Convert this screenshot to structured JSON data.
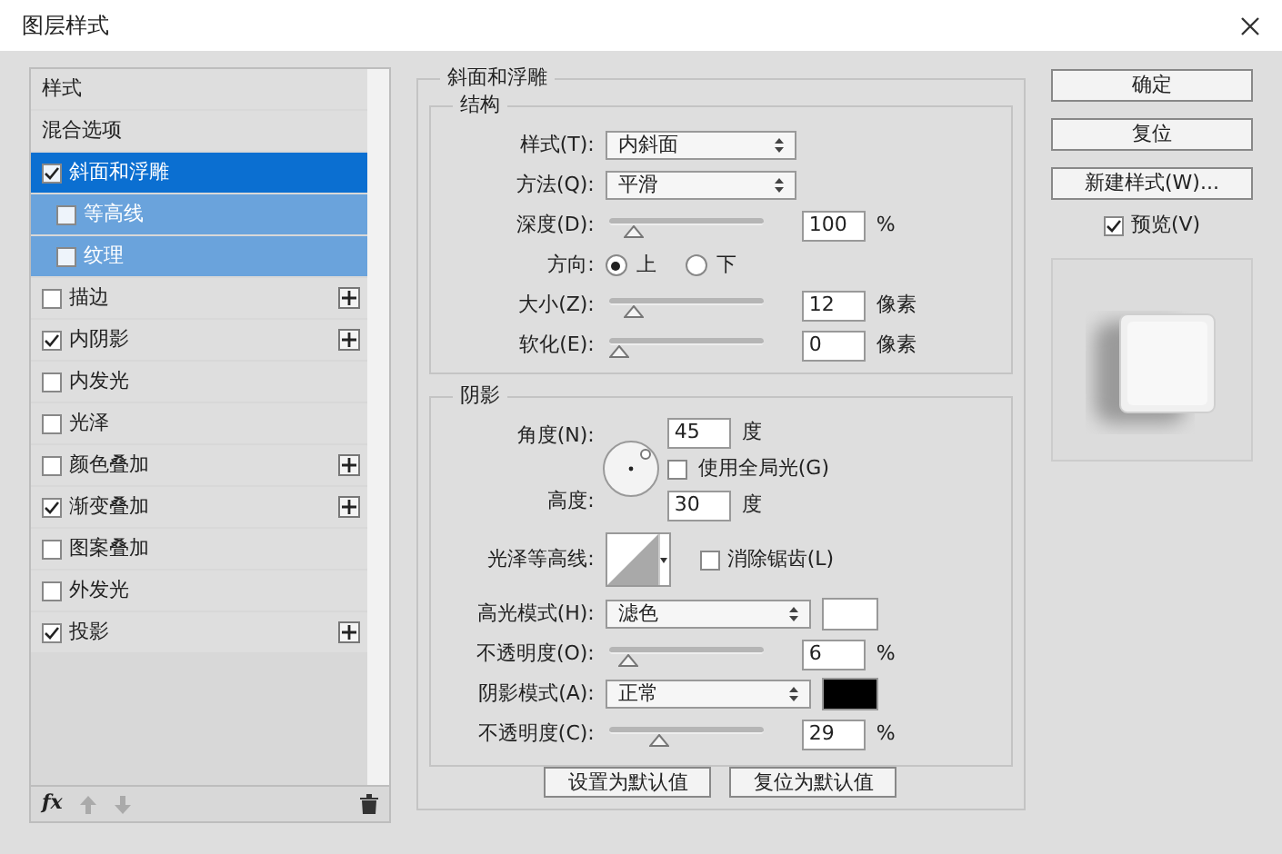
{
  "window": {
    "title": "图层样式"
  },
  "styles": [
    {
      "label": "样式",
      "kind": "header",
      "selected": false
    },
    {
      "label": "混合选项",
      "kind": "header",
      "selected": false
    },
    {
      "label": "斜面和浮雕",
      "kind": "effect",
      "checked": true,
      "selected": true,
      "add": false
    },
    {
      "label": "等高线",
      "kind": "sub",
      "checked": false,
      "selected": false,
      "add": false
    },
    {
      "label": "纹理",
      "kind": "sub",
      "checked": false,
      "selected": false,
      "add": false
    },
    {
      "label": "描边",
      "kind": "effect",
      "checked": false,
      "selected": false,
      "add": true
    },
    {
      "label": "内阴影",
      "kind": "effect",
      "checked": true,
      "selected": false,
      "add": true
    },
    {
      "label": "内发光",
      "kind": "effect",
      "checked": false,
      "selected": false,
      "add": false
    },
    {
      "label": "光泽",
      "kind": "effect",
      "checked": false,
      "selected": false,
      "add": false
    },
    {
      "label": "颜色叠加",
      "kind": "effect",
      "checked": false,
      "selected": false,
      "add": true
    },
    {
      "label": "渐变叠加",
      "kind": "effect",
      "checked": true,
      "selected": false,
      "add": true
    },
    {
      "label": "图案叠加",
      "kind": "effect",
      "checked": false,
      "selected": false,
      "add": false
    },
    {
      "label": "外发光",
      "kind": "effect",
      "checked": false,
      "selected": false,
      "add": false
    },
    {
      "label": "投影",
      "kind": "effect",
      "checked": true,
      "selected": false,
      "add": true
    }
  ],
  "list_toolbar": {
    "fx": "fx"
  },
  "bevel": {
    "title": "斜面和浮雕",
    "structure": {
      "title": "结构",
      "rows": [
        {
          "kind": "select",
          "label": "样式(T):",
          "value": "内斜面"
        },
        {
          "kind": "select",
          "label": "方法(Q):",
          "value": "平滑"
        },
        {
          "kind": "slider",
          "label": "深度(D):",
          "level": 0.1,
          "value": "100",
          "unit": "%"
        },
        {
          "kind": "radio",
          "label": "方向:",
          "options": [
            {
              "label": "上",
              "selected": true
            },
            {
              "label": "下",
              "selected": false
            }
          ]
        },
        {
          "kind": "slider",
          "label": "大小(Z):",
          "level": 0.1,
          "value": "12",
          "unit": "像素"
        },
        {
          "kind": "slider",
          "label": "软化(E):",
          "level": 0,
          "value": "0",
          "unit": "像素"
        }
      ]
    },
    "shading": {
      "title": "阴影",
      "angle": {
        "label": "角度(N):",
        "value": "45",
        "unit": "度"
      },
      "global_light": {
        "label": "使用全局光(G)",
        "checked": false
      },
      "altitude": {
        "label": "高度:",
        "value": "30",
        "unit": "度"
      },
      "gloss_contour": {
        "label": "光泽等高线:"
      },
      "anti_aliased": {
        "label": "消除锯齿(L)",
        "checked": false
      },
      "rows": [
        {
          "kind": "mode",
          "label": "高光模式(H):",
          "value": "滤色",
          "color": "#ffffff"
        },
        {
          "kind": "slider",
          "label": "不透明度(O):",
          "level": 0.06,
          "value": "6",
          "unit": "%"
        },
        {
          "kind": "mode",
          "label": "阴影模式(A):",
          "value": "正常",
          "color": "#000000"
        },
        {
          "kind": "slider",
          "label": "不透明度(C):",
          "level": 0.29,
          "value": "29",
          "unit": "%"
        }
      ]
    },
    "buttons": [
      "设置为默认值",
      "复位为默认值"
    ]
  },
  "side_buttons": [
    "确定",
    "复位",
    "新建样式(W)..."
  ],
  "preview": {
    "label": "预览(V)",
    "checked": true
  }
}
